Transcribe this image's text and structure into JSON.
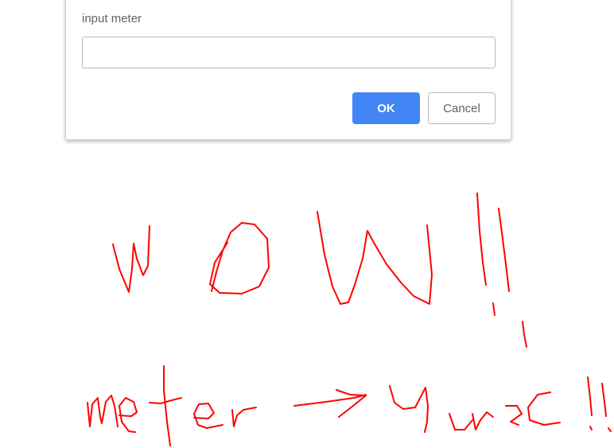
{
  "dialog": {
    "message": "input meter",
    "input_value": "",
    "ok_label": "OK",
    "cancel_label": "Cancel"
  },
  "annotation": {
    "color": "#ff0000",
    "line1": "wow!!",
    "line2": "meter → Yard!!"
  },
  "colors": {
    "primary_button": "#4285f4",
    "dialog_text": "#5f6368"
  }
}
